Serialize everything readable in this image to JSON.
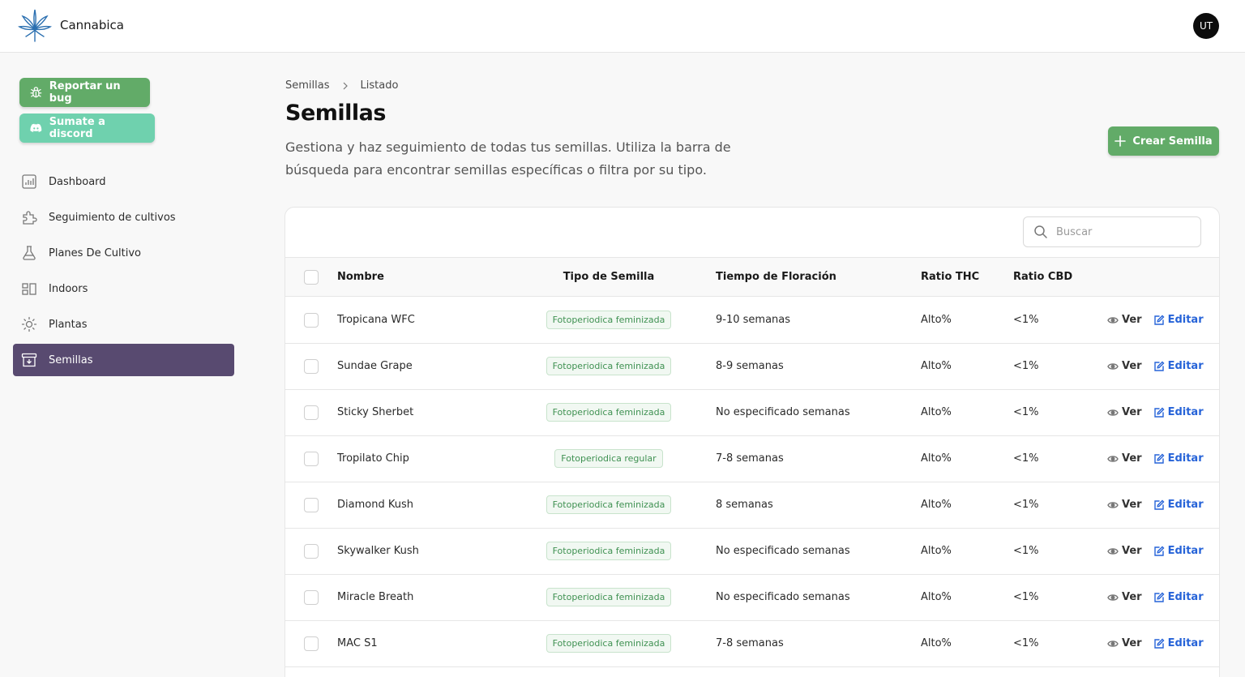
{
  "app": {
    "title": "Cannabica",
    "user_initials": "UT"
  },
  "sidebar": {
    "bug_button": "Reportar un bug",
    "discord_button": "Sumate a discord",
    "items": [
      {
        "label": "Dashboard",
        "icon": "chart-icon"
      },
      {
        "label": "Seguimiento de cultivos",
        "icon": "puzzle-icon"
      },
      {
        "label": "Planes De Cultivo",
        "icon": "flask-icon"
      },
      {
        "label": "Indoors",
        "icon": "grid-icon"
      },
      {
        "label": "Plantas",
        "icon": "sun-icon"
      },
      {
        "label": "Semillas",
        "icon": "archive-icon",
        "active": true
      }
    ]
  },
  "breadcrumb": {
    "parent": "Semillas",
    "current": "Listado"
  },
  "page": {
    "title": "Semillas",
    "description": "Gestiona y haz seguimiento de todas tus semillas. Utiliza la barra de búsqueda para encontrar semillas específicas o filtra por su tipo.",
    "create_button": "Crear Semilla"
  },
  "search": {
    "placeholder": "Buscar"
  },
  "table": {
    "columns": [
      "Nombre",
      "Tipo de Semilla",
      "Tiempo de Floración",
      "Ratio THC",
      "Ratio CBD"
    ],
    "view_label": "Ver",
    "edit_label": "Editar",
    "rows": [
      {
        "name": "Tropicana WFC",
        "type": "Fotoperiodica feminizada",
        "flowering": "9-10 semanas",
        "thc": "Alto%",
        "cbd": "<1%"
      },
      {
        "name": "Sundae Grape",
        "type": "Fotoperiodica feminizada",
        "flowering": "8-9 semanas",
        "thc": "Alto%",
        "cbd": "<1%"
      },
      {
        "name": "Sticky Sherbet",
        "type": "Fotoperiodica feminizada",
        "flowering": "No especificado semanas",
        "thc": "Alto%",
        "cbd": "<1%"
      },
      {
        "name": "Tropilato Chip",
        "type": "Fotoperiodica regular",
        "flowering": "7-8 semanas",
        "thc": "Alto%",
        "cbd": "<1%"
      },
      {
        "name": "Diamond Kush",
        "type": "Fotoperiodica feminizada",
        "flowering": "8 semanas",
        "thc": "Alto%",
        "cbd": "<1%"
      },
      {
        "name": "Skywalker Kush",
        "type": "Fotoperiodica feminizada",
        "flowering": "No especificado semanas",
        "thc": "Alto%",
        "cbd": "<1%"
      },
      {
        "name": "Miracle Breath",
        "type": "Fotoperiodica feminizada",
        "flowering": "No especificado semanas",
        "thc": "Alto%",
        "cbd": "<1%"
      },
      {
        "name": "MAC S1",
        "type": "Fotoperiodica feminizada",
        "flowering": "7-8 semanas",
        "thc": "Alto%",
        "cbd": "<1%"
      }
    ]
  },
  "colors": {
    "primary_green": "#62ab68",
    "discord_green": "#6fd1ae",
    "active_nav": "#584a70",
    "edit_blue": "#2663d8",
    "logo_blue": "#2a6fb0"
  }
}
